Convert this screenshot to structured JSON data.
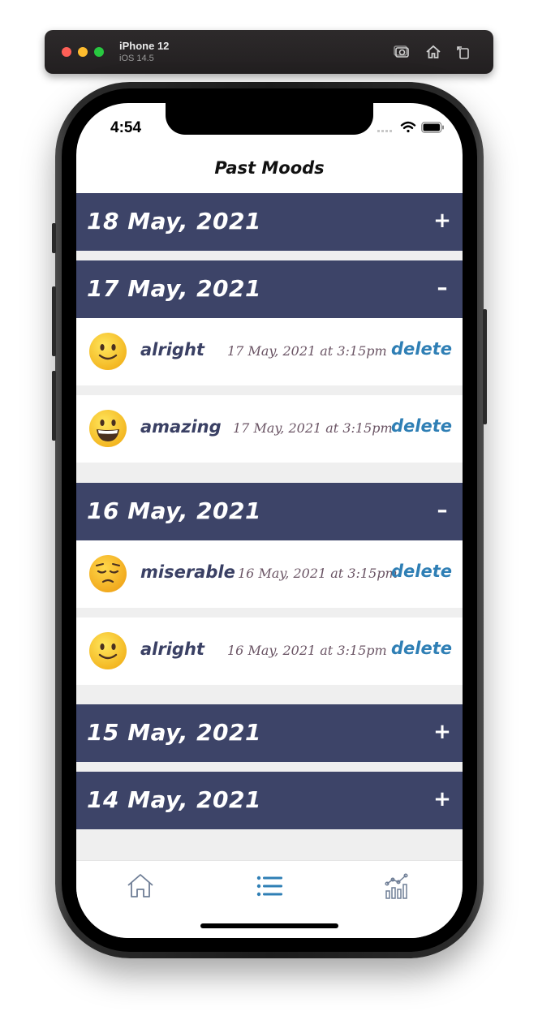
{
  "simulator": {
    "device_name": "iPhone 12",
    "os_version": "iOS 14.5",
    "controls": [
      "screenshot-icon",
      "home-icon",
      "rotate-icon"
    ]
  },
  "status_bar": {
    "time": "4:54",
    "icons": [
      "cellular-icon",
      "wifi-icon",
      "battery-icon"
    ]
  },
  "nav": {
    "title": "Past Moods"
  },
  "sections": [
    {
      "date": "18 May, 2021",
      "toggle": "+",
      "expanded": false,
      "entries": []
    },
    {
      "date": "17 May, 2021",
      "toggle": "–",
      "expanded": true,
      "entries": [
        {
          "emoji": "slightly-smiling-face",
          "mood": "alright",
          "timestamp": "17 May, 2021 at 3:15pm",
          "action": "delete"
        },
        {
          "emoji": "grinning-face",
          "mood": "amazing",
          "timestamp": "17 May, 2021 at 3:15pm",
          "action": "delete"
        }
      ]
    },
    {
      "date": "16 May, 2021",
      "toggle": "–",
      "expanded": true,
      "entries": [
        {
          "emoji": "pensive-face",
          "mood": "miserable",
          "timestamp": "16 May, 2021 at 3:15pm",
          "action": "delete"
        },
        {
          "emoji": "slightly-smiling-face",
          "mood": "alright",
          "timestamp": "16 May, 2021 at 3:15pm",
          "action": "delete"
        }
      ]
    },
    {
      "date": "15 May, 2021",
      "toggle": "+",
      "expanded": false,
      "entries": []
    },
    {
      "date": "14 May, 2021",
      "toggle": "+",
      "expanded": false,
      "entries": []
    }
  ],
  "tabbar": {
    "tabs": [
      {
        "name": "home",
        "icon": "home-icon",
        "active": false
      },
      {
        "name": "list",
        "icon": "list-icon",
        "active": true
      },
      {
        "name": "stats",
        "icon": "chart-icon",
        "active": false
      }
    ]
  },
  "colors": {
    "header_bg": "#3d4468",
    "mood_text": "#3a4064",
    "date_text": "#6b5565",
    "delete": "#2f7fb5",
    "active_tab": "#2f7fb5",
    "inactive_tab": "#6f7e96",
    "list_bg": "#efefef"
  }
}
